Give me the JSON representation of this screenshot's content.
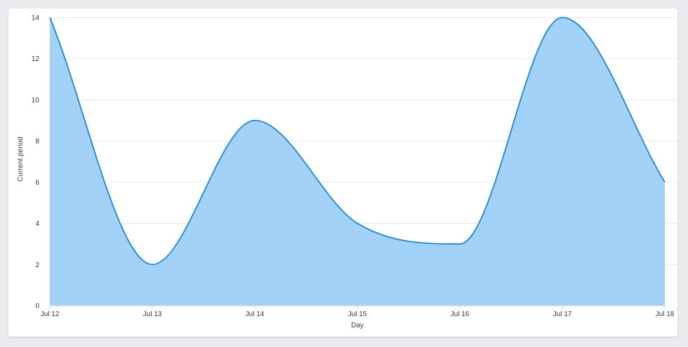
{
  "chart_data": {
    "type": "area",
    "title": "",
    "xlabel": "Day",
    "ylabel": "Current period",
    "categories": [
      "Jul 12",
      "Jul 13",
      "Jul 14",
      "Jul 15",
      "Jul 16",
      "Jul 17",
      "Jul 18"
    ],
    "series": [
      {
        "values": [
          14,
          2,
          9,
          4,
          3,
          14,
          6
        ]
      }
    ],
    "ylim": [
      0,
      14
    ],
    "yticks": [
      0,
      2,
      4,
      6,
      8,
      10,
      12,
      14
    ],
    "grid": "horizontal",
    "legend": "none",
    "colors": {
      "line": "#1f86d8",
      "fill": "#a2d2f7",
      "grid": "#e4e6ea"
    }
  }
}
